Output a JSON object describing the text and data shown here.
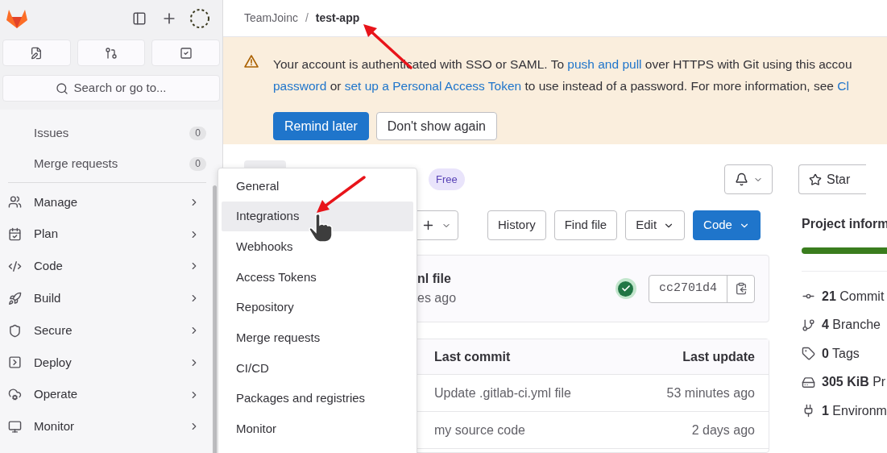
{
  "sidebar": {
    "search": {
      "placeholder": "Search or go to..."
    },
    "pinned": [
      {
        "label": "Issues",
        "count": "0"
      },
      {
        "label": "Merge requests",
        "count": "0"
      }
    ],
    "sections": [
      {
        "label": "Manage"
      },
      {
        "label": "Plan"
      },
      {
        "label": "Code"
      },
      {
        "label": "Build"
      },
      {
        "label": "Secure"
      },
      {
        "label": "Deploy"
      },
      {
        "label": "Operate"
      },
      {
        "label": "Monitor"
      }
    ]
  },
  "breadcrumb": {
    "items": [
      "TeamJoinc",
      "test-app"
    ],
    "separator": "/"
  },
  "banner": {
    "lines": [
      [
        {
          "text": "Your account is authenticated with SSO or SAML. To ",
          "link": false
        },
        {
          "text": "push and pull",
          "link": true
        },
        {
          "text": " over HTTPS with Git using this accou",
          "link": false
        }
      ],
      [
        {
          "text": "password",
          "link": true
        },
        {
          "text": " or ",
          "link": false
        },
        {
          "text": "set up a Personal Access Token",
          "link": true
        },
        {
          "text": " to use instead of a password. For more information, see ",
          "link": false
        },
        {
          "text": "Cl",
          "link": true
        }
      ]
    ],
    "buttons": [
      {
        "label": "Remind later",
        "kind": "primary"
      },
      {
        "label": "Don't show again",
        "kind": "secondary"
      }
    ]
  },
  "project": {
    "badge": "Free",
    "star": "Star"
  },
  "toolbar": [
    {
      "label": "History",
      "kind": "default",
      "dropdown": false
    },
    {
      "label": "Find file",
      "kind": "default",
      "dropdown": false
    },
    {
      "label": "Edit",
      "kind": "default",
      "dropdown": true
    },
    {
      "label": "Code",
      "kind": "primary",
      "dropdown": true
    }
  ],
  "commit": {
    "title": "nl file",
    "time": "es ago",
    "sha": "cc2701d4"
  },
  "files": {
    "columns": [
      "Last commit",
      "Last update"
    ],
    "rows": [
      [
        "Update .gitlab-ci.yml file",
        "53 minutes ago"
      ],
      [
        "my source code",
        "2 days ago"
      ]
    ]
  },
  "project_info": {
    "title": "Project inform",
    "stats": [
      {
        "value": "21",
        "label": "Commit"
      },
      {
        "value": "4",
        "label": "Branche"
      },
      {
        "value": "0",
        "label": "Tags"
      },
      {
        "value": "305 KiB",
        "label": "Pr"
      },
      {
        "value": "1",
        "label": "Environm"
      }
    ]
  },
  "menu": {
    "items": [
      {
        "label": "General",
        "selected": false
      },
      {
        "label": "Integrations",
        "selected": true
      },
      {
        "label": "Webhooks",
        "selected": false
      },
      {
        "label": "Access Tokens",
        "selected": false
      },
      {
        "label": "Repository",
        "selected": false
      },
      {
        "label": "Merge requests",
        "selected": false
      },
      {
        "label": "CI/CD",
        "selected": false
      },
      {
        "label": "Packages and registries",
        "selected": false
      },
      {
        "label": "Monitor",
        "selected": false
      }
    ]
  }
}
